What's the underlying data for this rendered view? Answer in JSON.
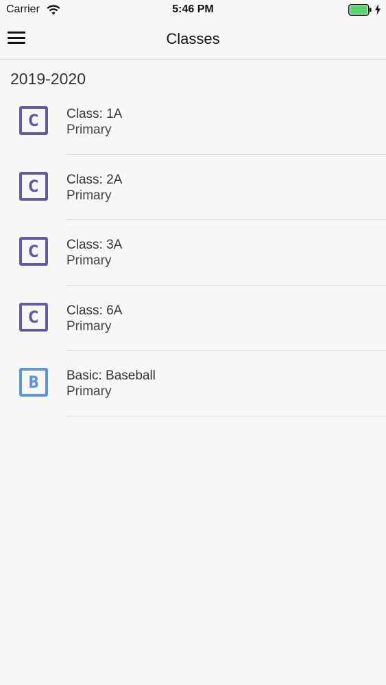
{
  "status_bar": {
    "carrier": "Carrier",
    "time": "5:46 PM",
    "battery_color": "#4cd964"
  },
  "nav": {
    "title": "Classes",
    "menu_icon": "hamburger-menu-icon"
  },
  "section": {
    "header": "2019-2020"
  },
  "items": [
    {
      "icon_letter": "C",
      "icon_color": "#6755a6",
      "title": "Class: 1A",
      "subtitle": "Primary"
    },
    {
      "icon_letter": "C",
      "icon_color": "#6755a6",
      "title": "Class: 2A",
      "subtitle": "Primary"
    },
    {
      "icon_letter": "C",
      "icon_color": "#6755a6",
      "title": "Class: 3A",
      "subtitle": "Primary"
    },
    {
      "icon_letter": "C",
      "icon_color": "#6755a6",
      "title": "Class: 6A",
      "subtitle": "Primary"
    },
    {
      "icon_letter": "B",
      "icon_color": "#5b93e0",
      "title": "Basic: Baseball",
      "subtitle": "Primary"
    }
  ]
}
